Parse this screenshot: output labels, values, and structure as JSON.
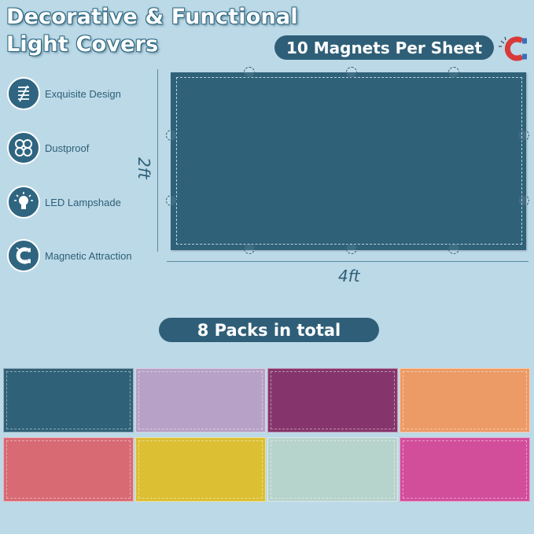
{
  "title": {
    "line1": "Decorative & Functional",
    "line2": "Light Covers"
  },
  "magnets_badge": "10 Magnets Per Sheet",
  "features": [
    {
      "icon": "design-lines-icon",
      "label": "Exquisite Design"
    },
    {
      "icon": "clover-dustproof-icon",
      "label": "Dustproof"
    },
    {
      "icon": "led-bulb-icon",
      "label": "LED Lampshade"
    },
    {
      "icon": "magnet-icon",
      "label": "Magnetic Attraction"
    }
  ],
  "dimensions": {
    "height": "2ft",
    "width": "4ft"
  },
  "packs_badge": "8 Packs in total",
  "colors": {
    "sheet": "#2f6178",
    "accent": "#2f5f78",
    "background": "#bcd9e7",
    "swatches": [
      "#2f6178",
      "#b7a1c6",
      "#86356c",
      "#ed9b66",
      "#d86a74",
      "#dcbf32",
      "#b6d3cc",
      "#d24e9b"
    ]
  }
}
